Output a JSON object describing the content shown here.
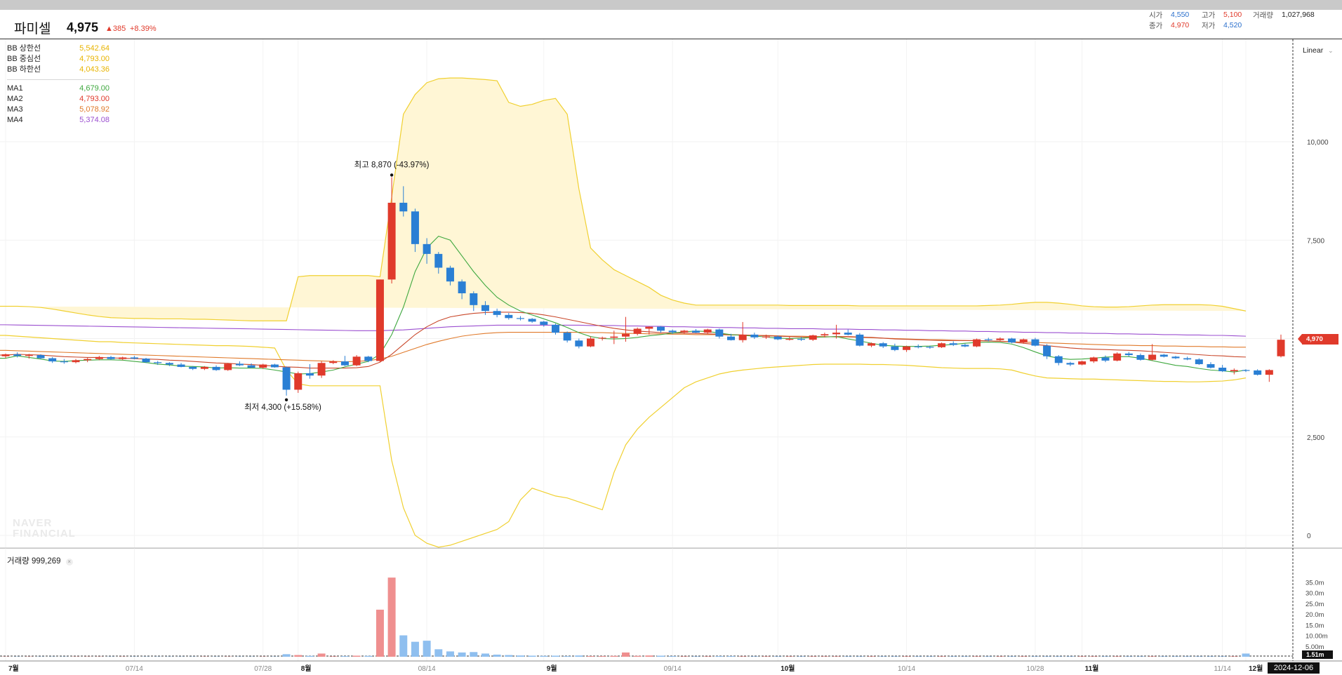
{
  "stock": {
    "name": "파미셀",
    "price": "4,975",
    "change": "▲385",
    "change_rate": "+8.39%"
  },
  "stats": {
    "open_label": "시가",
    "open": "4,550",
    "high_label": "고가",
    "high": "5,100",
    "volume_label": "거래량",
    "volume": "1,027,968",
    "close_label": "종가",
    "close": "4,970",
    "low_label": "저가",
    "low": "4,520"
  },
  "legend": {
    "bb": [
      {
        "name": "BB 상한선",
        "value": "5,542.64",
        "color": "#e8b400"
      },
      {
        "name": "BB 중심선",
        "value": "4,793.00",
        "color": "#e8b400"
      },
      {
        "name": "BB 하한선",
        "value": "4,043.36",
        "color": "#e8b400"
      }
    ],
    "ma": [
      {
        "name": "MA1",
        "value": "4,679.00",
        "color": "#3fa83f"
      },
      {
        "name": "MA2",
        "value": "4,793.00",
        "color": "#e03a2b"
      },
      {
        "name": "MA3",
        "value": "5,078.92",
        "color": "#e07a2b"
      },
      {
        "name": "MA4",
        "value": "5,374.08",
        "color": "#9b4fd0"
      }
    ]
  },
  "annotations": {
    "max": "최고 8,870 (-43.97%)",
    "min": "최저 4,300 (+15.58%)"
  },
  "scale_mode": "Linear",
  "watermark": {
    "line1": "NAVER",
    "line2": "FINANCIAL"
  },
  "current_price_badge": "4,970",
  "volume_panel": {
    "label": "거래량",
    "value": "999,269",
    "close_icon": "×"
  },
  "volume_badge": "1.51m",
  "cursor_date": "2024-12-06",
  "colors": {
    "up": "#e03a2b",
    "down": "#2a7fd4",
    "bb": "#f0d030",
    "bb_fill": "#fff6d5"
  },
  "chart_data": {
    "type": "candlestick",
    "price_axis": {
      "ticks": [
        0,
        2500,
        5000,
        7500,
        10000
      ],
      "tick_labels": [
        "0",
        "2,500",
        "5,000",
        "7,500",
        "10,000"
      ],
      "scale": "linear"
    },
    "volume_axis": {
      "ticks": [
        5,
        10,
        15,
        20,
        25,
        30,
        35
      ],
      "tick_labels": [
        "5.00m",
        "10.00m",
        "15.0m",
        "20.0m",
        "25.0m",
        "30.0m",
        "35.0m"
      ]
    },
    "x_axis_labels": [
      "7월",
      "07/14",
      "07/28",
      "8월",
      "08/14",
      "9월",
      "09/14",
      "10월",
      "10/14",
      "10/28",
      "11월",
      "11/14",
      "12월"
    ],
    "candles": [
      [
        4550,
        4620,
        4500,
        4600
      ],
      [
        4600,
        4650,
        4520,
        4560
      ],
      [
        4560,
        4610,
        4490,
        4580
      ],
      [
        4580,
        4600,
        4480,
        4500
      ],
      [
        4500,
        4530,
        4380,
        4420
      ],
      [
        4420,
        4480,
        4360,
        4400
      ],
      [
        4400,
        4480,
        4370,
        4450
      ],
      [
        4450,
        4520,
        4400,
        4480
      ],
      [
        4480,
        4560,
        4450,
        4530
      ],
      [
        4530,
        4560,
        4460,
        4480
      ],
      [
        4480,
        4540,
        4450,
        4520
      ],
      [
        4520,
        4560,
        4470,
        4490
      ],
      [
        4490,
        4510,
        4380,
        4400
      ],
      [
        4400,
        4430,
        4330,
        4380
      ],
      [
        4380,
        4400,
        4300,
        4340
      ],
      [
        4340,
        4380,
        4270,
        4280
      ],
      [
        4280,
        4300,
        4200,
        4230
      ],
      [
        4230,
        4300,
        4200,
        4280
      ],
      [
        4280,
        4320,
        4180,
        4200
      ],
      [
        4200,
        4380,
        4180,
        4360
      ],
      [
        4360,
        4420,
        4300,
        4320
      ],
      [
        4320,
        4370,
        4250,
        4260
      ],
      [
        4260,
        4360,
        4230,
        4340
      ],
      [
        4340,
        4360,
        4260,
        4270
      ],
      [
        4270,
        4290,
        3550,
        3700
      ],
      [
        3700,
        4160,
        3620,
        4120
      ],
      [
        4120,
        4350,
        3980,
        4060
      ],
      [
        4060,
        4420,
        4000,
        4380
      ],
      [
        4380,
        4450,
        4350,
        4420
      ],
      [
        4420,
        4560,
        4300,
        4320
      ],
      [
        4320,
        4580,
        4300,
        4540
      ],
      [
        4540,
        4560,
        4400,
        4430
      ],
      [
        4430,
        6500,
        4400,
        6500
      ],
      [
        6500,
        9100,
        6400,
        8450
      ],
      [
        8450,
        8870,
        8100,
        8230
      ],
      [
        8230,
        8300,
        7200,
        7400
      ],
      [
        7400,
        7550,
        6900,
        7150
      ],
      [
        7150,
        7200,
        6650,
        6800
      ],
      [
        6800,
        6850,
        6350,
        6450
      ],
      [
        6450,
        6500,
        6000,
        6150
      ],
      [
        6150,
        6200,
        5700,
        5850
      ],
      [
        5850,
        5950,
        5600,
        5700
      ],
      [
        5700,
        5760,
        5540,
        5600
      ],
      [
        5600,
        5650,
        5480,
        5520
      ],
      [
        5520,
        5570,
        5460,
        5500
      ],
      [
        5500,
        5520,
        5400,
        5430
      ],
      [
        5430,
        5450,
        5300,
        5350
      ],
      [
        5350,
        5380,
        5100,
        5150
      ],
      [
        5150,
        5180,
        4900,
        4950
      ],
      [
        4950,
        5000,
        4750,
        4800
      ],
      [
        4800,
        5050,
        4780,
        5000
      ],
      [
        5000,
        5050,
        4950,
        5020
      ],
      [
        5020,
        5200,
        4860,
        5050
      ],
      [
        5050,
        5550,
        4920,
        5120
      ],
      [
        5120,
        5280,
        5080,
        5250
      ],
      [
        5250,
        5310,
        5100,
        5300
      ],
      [
        5300,
        5320,
        5150,
        5200
      ],
      [
        5200,
        5230,
        5120,
        5160
      ],
      [
        5160,
        5220,
        5120,
        5200
      ],
      [
        5200,
        5240,
        5140,
        5150
      ],
      [
        5150,
        5250,
        5120,
        5230
      ],
      [
        5230,
        5250,
        5000,
        5050
      ],
      [
        5050,
        5120,
        4950,
        4960
      ],
      [
        4960,
        5420,
        4900,
        5100
      ],
      [
        5100,
        5150,
        4990,
        5030
      ],
      [
        5030,
        5100,
        4990,
        5050
      ],
      [
        5050,
        5080,
        4960,
        4980
      ],
      [
        4980,
        5060,
        4950,
        4990
      ],
      [
        4990,
        5040,
        4940,
        4970
      ],
      [
        4970,
        5100,
        4940,
        5080
      ],
      [
        5080,
        5150,
        5030,
        5110
      ],
      [
        5110,
        5350,
        5000,
        5150
      ],
      [
        5150,
        5230,
        5080,
        5100
      ],
      [
        5100,
        5140,
        4800,
        4820
      ],
      [
        4820,
        4900,
        4780,
        4880
      ],
      [
        4880,
        4910,
        4760,
        4800
      ],
      [
        4800,
        4870,
        4680,
        4710
      ],
      [
        4710,
        4820,
        4660,
        4800
      ],
      [
        4800,
        4850,
        4750,
        4790
      ],
      [
        4790,
        4820,
        4740,
        4780
      ],
      [
        4780,
        4900,
        4760,
        4880
      ],
      [
        4880,
        4930,
        4810,
        4840
      ],
      [
        4840,
        4870,
        4780,
        4800
      ],
      [
        4800,
        5000,
        4780,
        4980
      ],
      [
        4980,
        5020,
        4930,
        4960
      ],
      [
        4960,
        5030,
        4940,
        5000
      ],
      [
        5000,
        5020,
        4880,
        4900
      ],
      [
        4900,
        5000,
        4870,
        4980
      ],
      [
        4980,
        5020,
        4800,
        4820
      ],
      [
        4820,
        4860,
        4480,
        4550
      ],
      [
        4550,
        4580,
        4320,
        4380
      ],
      [
        4380,
        4410,
        4300,
        4340
      ],
      [
        4340,
        4440,
        4320,
        4420
      ],
      [
        4420,
        4540,
        4380,
        4520
      ],
      [
        4520,
        4570,
        4400,
        4440
      ],
      [
        4440,
        4650,
        4420,
        4620
      ],
      [
        4620,
        4660,
        4540,
        4580
      ],
      [
        4580,
        4620,
        4440,
        4460
      ],
      [
        4460,
        4860,
        4440,
        4590
      ],
      [
        4590,
        4610,
        4520,
        4540
      ],
      [
        4540,
        4560,
        4480,
        4500
      ],
      [
        4500,
        4540,
        4450,
        4470
      ],
      [
        4470,
        4500,
        4330,
        4350
      ],
      [
        4350,
        4400,
        4240,
        4260
      ],
      [
        4260,
        4330,
        4150,
        4170
      ],
      [
        4170,
        4240,
        4090,
        4200
      ],
      [
        4200,
        4220,
        4150,
        4190
      ],
      [
        4190,
        4220,
        4060,
        4080
      ],
      [
        4080,
        4220,
        3900,
        4200
      ],
      [
        4550,
        5100,
        4520,
        4970
      ]
    ],
    "ma1": [
      4500,
      4560,
      4520,
      4480,
      4430,
      4420,
      4440,
      4450,
      4460,
      4460,
      4450,
      4420,
      4390,
      4350,
      4330,
      4300,
      4290,
      4280,
      4250,
      4260,
      4250,
      4250,
      4240,
      4200,
      4150,
      4100,
      4110,
      4150,
      4200,
      4280,
      4350,
      4420,
      4600,
      5100,
      5800,
      6700,
      7300,
      7600,
      7500,
      7100,
      6700,
      6350,
      6050,
      5850,
      5700,
      5600,
      5500,
      5400,
      5280,
      5150,
      5050,
      5000,
      4990,
      5000,
      5030,
      5070,
      5100,
      5140,
      5170,
      5190,
      5180,
      5140,
      5100,
      5080,
      5060,
      5040,
      5010,
      5000,
      5010,
      5030,
      5040,
      5050,
      4990,
      4940,
      4880,
      4830,
      4810,
      4800,
      4800,
      4810,
      4830,
      4850,
      4880,
      4900,
      4910,
      4900,
      4860,
      4770,
      4660,
      4560,
      4500,
      4470,
      4480,
      4500,
      4530,
      4540,
      4540,
      4500,
      4440,
      4380,
      4320,
      4290,
      4240,
      4200,
      4180,
      4150,
      4200
    ],
    "ma2": [
      4580,
      4600,
      4590,
      4580,
      4560,
      4540,
      4530,
      4520,
      4520,
      4510,
      4500,
      4490,
      4480,
      4470,
      4450,
      4440,
      4420,
      4400,
      4380,
      4370,
      4350,
      4340,
      4320,
      4300,
      4280,
      4270,
      4250,
      4250,
      4250,
      4250,
      4260,
      4290,
      4400,
      4600,
      4850,
      5100,
      5300,
      5450,
      5550,
      5600,
      5640,
      5660,
      5670,
      5670,
      5660,
      5640,
      5600,
      5550,
      5490,
      5430,
      5370,
      5310,
      5260,
      5220,
      5190,
      5170,
      5150,
      5140,
      5140,
      5130,
      5120,
      5110,
      5100,
      5090,
      5080,
      5070,
      5060,
      5050,
      5040,
      5040,
      5040,
      5050,
      5050,
      5040,
      5030,
      5010,
      4990,
      4980,
      4970,
      4960,
      4950,
      4950,
      4950,
      4950,
      4940,
      4930,
      4910,
      4880,
      4850,
      4820,
      4790,
      4760,
      4740,
      4730,
      4720,
      4710,
      4700,
      4690,
      4670,
      4650,
      4630,
      4610,
      4590,
      4570,
      4560,
      4540,
      4530
    ],
    "ma3": [
      4700,
      4690,
      4680,
      4670,
      4660,
      4650,
      4640,
      4630,
      4620,
      4610,
      4600,
      4590,
      4580,
      4570,
      4560,
      4550,
      4540,
      4530,
      4520,
      4510,
      4500,
      4490,
      4480,
      4470,
      4460,
      4450,
      4440,
      4430,
      4420,
      4410,
      4420,
      4440,
      4480,
      4550,
      4650,
      4750,
      4850,
      4930,
      5000,
      5060,
      5100,
      5130,
      5150,
      5160,
      5160,
      5160,
      5160,
      5160,
      5160,
      5160,
      5150,
      5150,
      5140,
      5130,
      5130,
      5120,
      5120,
      5110,
      5110,
      5100,
      5100,
      5100,
      5090,
      5090,
      5080,
      5080,
      5070,
      5060,
      5060,
      5050,
      5050,
      5040,
      5040,
      5030,
      5020,
      5010,
      5000,
      4990,
      4980,
      4970,
      4970,
      4960,
      4950,
      4940,
      4940,
      4930,
      4920,
      4910,
      4900,
      4890,
      4880,
      4870,
      4860,
      4850,
      4840,
      4830,
      4830,
      4820,
      4820,
      4810,
      4810,
      4800,
      4800,
      4790,
      4790,
      4780,
      4780
    ],
    "ma4": [
      5350,
      5345,
      5340,
      5335,
      5330,
      5325,
      5320,
      5315,
      5310,
      5305,
      5300,
      5295,
      5290,
      5285,
      5280,
      5275,
      5270,
      5265,
      5260,
      5255,
      5250,
      5245,
      5240,
      5235,
      5230,
      5225,
      5220,
      5215,
      5210,
      5205,
      5200,
      5200,
      5200,
      5210,
      5220,
      5240,
      5260,
      5280,
      5300,
      5310,
      5320,
      5330,
      5340,
      5340,
      5340,
      5340,
      5340,
      5340,
      5340,
      5340,
      5330,
      5330,
      5330,
      5320,
      5320,
      5310,
      5310,
      5300,
      5300,
      5290,
      5290,
      5280,
      5280,
      5270,
      5270,
      5260,
      5260,
      5250,
      5250,
      5250,
      5240,
      5240,
      5240,
      5230,
      5230,
      5220,
      5220,
      5210,
      5210,
      5200,
      5200,
      5190,
      5190,
      5180,
      5180,
      5170,
      5170,
      5160,
      5160,
      5150,
      5150,
      5140,
      5140,
      5130,
      5130,
      5120,
      5120,
      5110,
      5110,
      5100,
      5100,
      5090,
      5090,
      5080,
      5080,
      5070,
      5060
    ],
    "bb_upper": [
      5820,
      5820,
      5810,
      5790,
      5750,
      5700,
      5650,
      5600,
      5560,
      5530,
      5520,
      5510,
      5510,
      5500,
      5500,
      5500,
      5490,
      5490,
      5480,
      5470,
      5460,
      5450,
      5450,
      5450,
      5450,
      6570,
      6600,
      6600,
      6600,
      6600,
      6600,
      6600,
      6570,
      8600,
      10700,
      11200,
      11500,
      11600,
      11620,
      11620,
      11600,
      11580,
      11550,
      11000,
      10900,
      10950,
      11050,
      11100,
      10700,
      8800,
      7300,
      7000,
      6750,
      6600,
      6450,
      6300,
      6100,
      5980,
      5900,
      5850,
      5850,
      5850,
      5850,
      5850,
      5850,
      5850,
      5850,
      5840,
      5840,
      5840,
      5840,
      5840,
      5840,
      5830,
      5830,
      5830,
      5830,
      5830,
      5830,
      5830,
      5830,
      5830,
      5830,
      5830,
      5840,
      5850,
      5870,
      5900,
      5920,
      5920,
      5900,
      5870,
      5830,
      5810,
      5800,
      5800,
      5810,
      5830,
      5850,
      5860,
      5860,
      5860,
      5860,
      5850,
      5820,
      5760,
      5700
    ],
    "bb_lower": [
      5080,
      5060,
      5040,
      5020,
      5000,
      4980,
      4960,
      4940,
      4920,
      4920,
      4900,
      4890,
      4880,
      4870,
      4860,
      4850,
      4840,
      4830,
      4820,
      4820,
      4810,
      4800,
      4780,
      4760,
      4200,
      3850,
      3800,
      3800,
      3800,
      3800,
      3800,
      3800,
      3800,
      1900,
      700,
      0,
      -200,
      -300,
      -250,
      -150,
      -50,
      50,
      150,
      350,
      900,
      1200,
      1100,
      1000,
      950,
      850,
      750,
      650,
      1600,
      2300,
      2700,
      3000,
      3250,
      3500,
      3750,
      3900,
      4000,
      4100,
      4160,
      4200,
      4230,
      4260,
      4280,
      4300,
      4320,
      4340,
      4350,
      4350,
      4350,
      4350,
      4340,
      4340,
      4330,
      4320,
      4300,
      4280,
      4260,
      4250,
      4240,
      4240,
      4240,
      4230,
      4200,
      4120,
      4050,
      4000,
      3990,
      3980,
      3970,
      3970,
      3960,
      3950,
      3940,
      3930,
      3920,
      3910,
      3910,
      3900,
      3900,
      3910,
      3920,
      3950,
      4000
    ],
    "volume": [
      0.1,
      0.1,
      0.1,
      0.1,
      0.1,
      0.1,
      0.1,
      0.1,
      0.1,
      0.1,
      0.1,
      0.1,
      0.1,
      0.1,
      0.1,
      0.1,
      0.1,
      0.1,
      0.1,
      0.1,
      0.1,
      0.1,
      0.1,
      0.1,
      1.2,
      0.8,
      0.4,
      1.5,
      0.2,
      0.3,
      0.5,
      0.4,
      22,
      37,
      10,
      7,
      7.5,
      3.5,
      2.5,
      2,
      2.2,
      1.5,
      1,
      0.8,
      0.6,
      0.5,
      0.4,
      0.5,
      0.3,
      0.6,
      0.3,
      0.3,
      0.4,
      2,
      0.4,
      0.6,
      0.5,
      0.3,
      0.2,
      0.2,
      0.2,
      0.3,
      0.3,
      0.2,
      0.2,
      0.2,
      0.2,
      0.2,
      0.2,
      0.2,
      0.2,
      0.2,
      0.2,
      0.2,
      0.2,
      0.2,
      0.2,
      0.2,
      0.2,
      0.2,
      0.2,
      0.2,
      0.2,
      0.2,
      0.2,
      0.2,
      0.2,
      0.2,
      0.2,
      0.2,
      0.2,
      0.2,
      0.2,
      0.2,
      0.2,
      0.2,
      0.2,
      0.2,
      0.2,
      0.2,
      0.2,
      0.2,
      0.2,
      0.2,
      0.2,
      0.2,
      1.5
    ],
    "volume_colors_up": true
  }
}
